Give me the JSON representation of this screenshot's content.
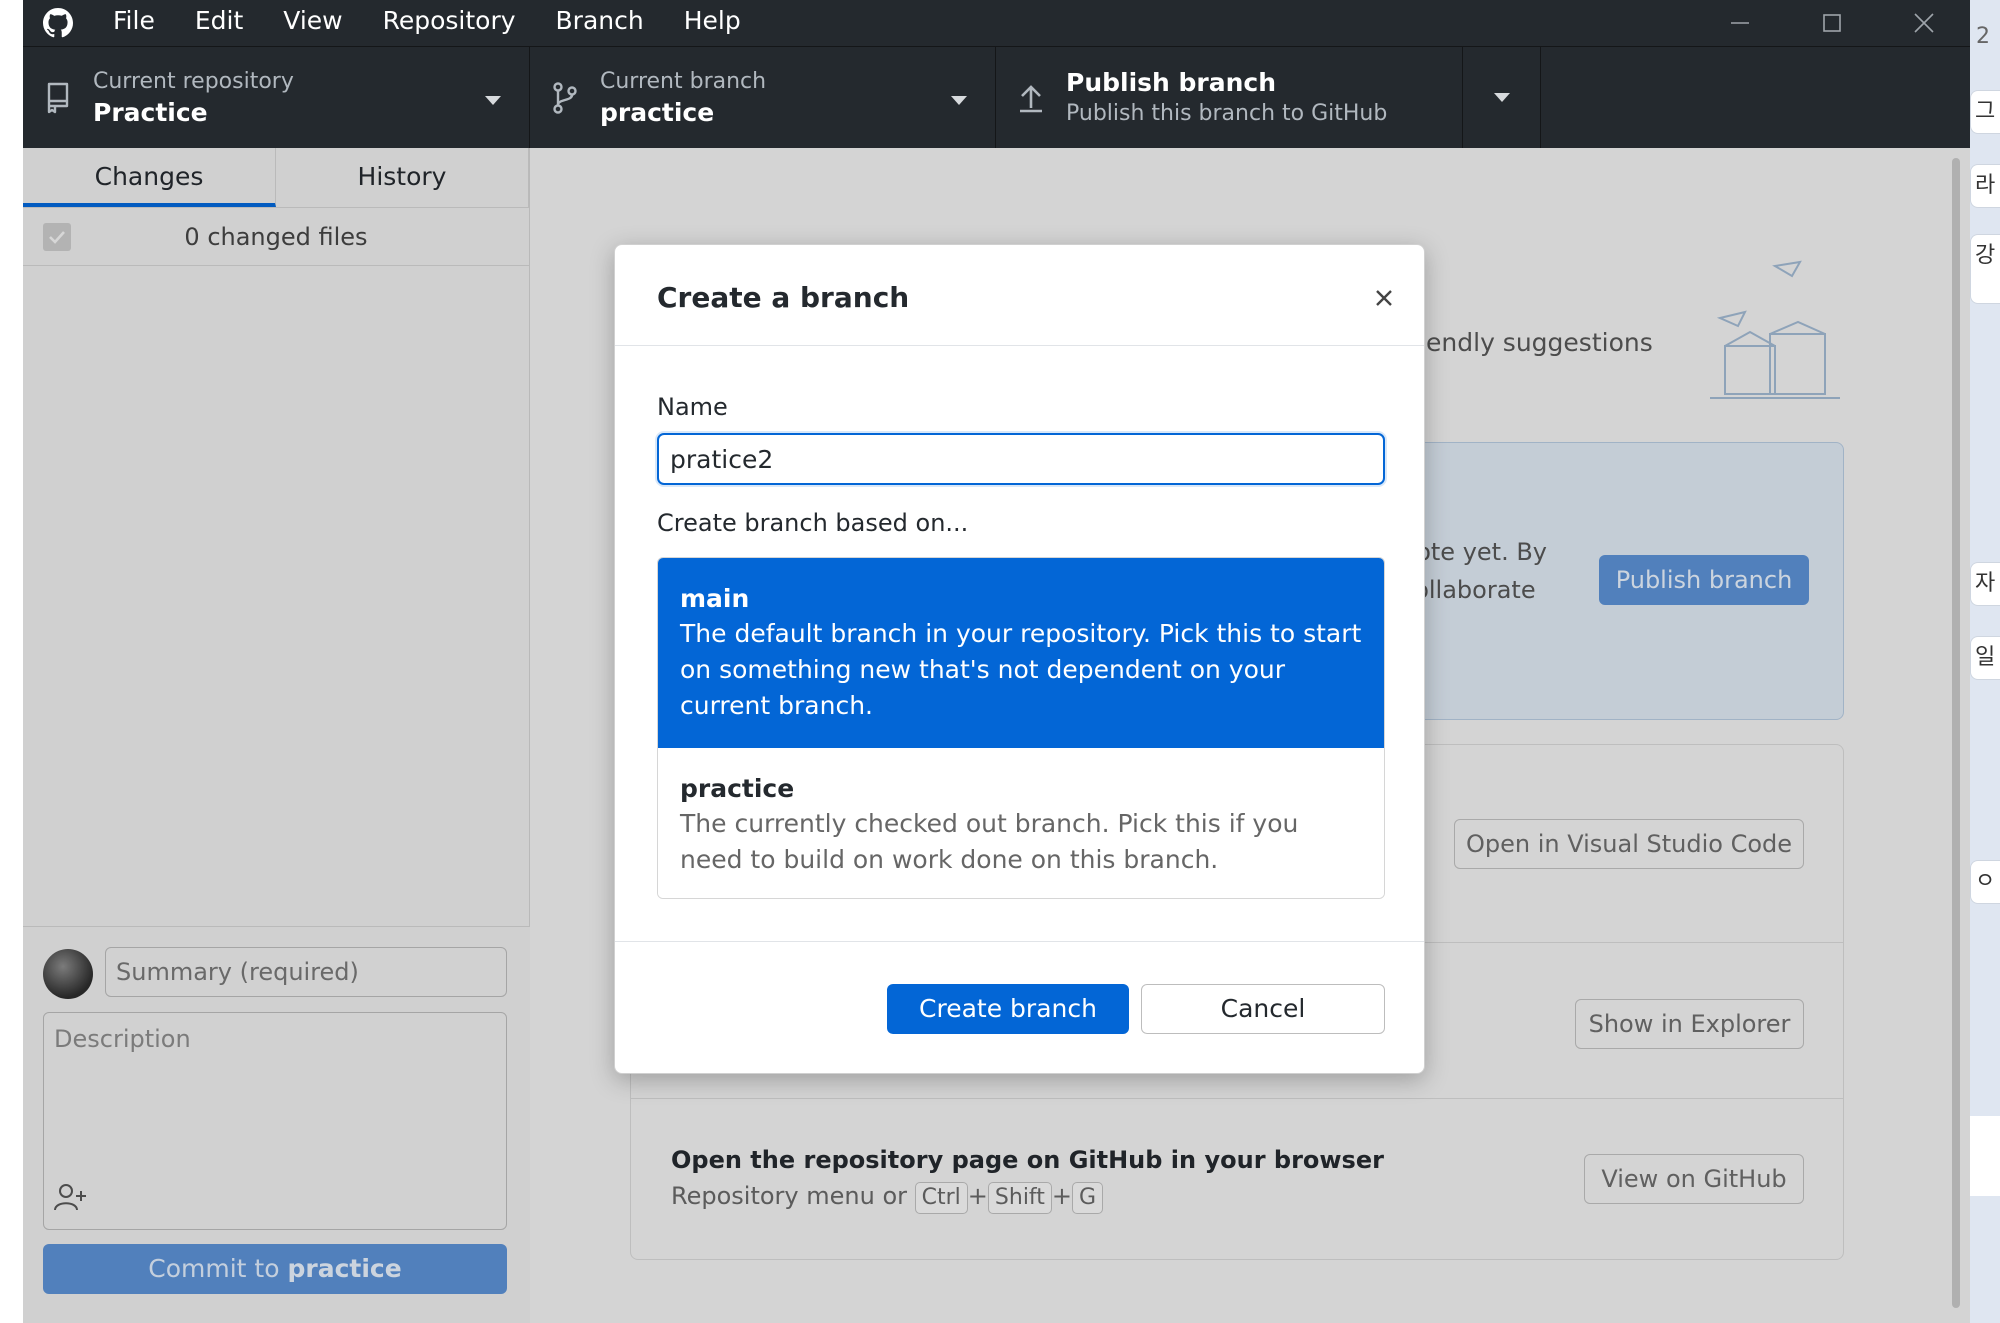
{
  "menu": [
    "File",
    "Edit",
    "View",
    "Repository",
    "Branch",
    "Help"
  ],
  "toolbar": {
    "repo_label": "Current repository",
    "repo_value": "Practice",
    "branch_label": "Current branch",
    "branch_value": "practice",
    "publish_title": "Publish branch",
    "publish_sub": "Publish this branch to GitHub"
  },
  "sidebar": {
    "tabs": [
      "Changes",
      "History"
    ],
    "changed_files": "0 changed files",
    "summary_placeholder": "Summary (required)",
    "description_placeholder": "Description",
    "commit_prefix": "Commit to",
    "commit_branch": "practice"
  },
  "main": {
    "friendly": "friendly suggestions",
    "publish_text_1": "note yet. By",
    "publish_text_2": "collaborate",
    "publish_button": "Publish branch",
    "open_editor_button": "Open in Visual Studio Code",
    "show_explorer_button": "Show in Explorer",
    "github_title": "Open the repository page on GitHub in your browser",
    "github_sub_prefix": "Repository menu or",
    "keys": [
      "Ctrl",
      "Shift",
      "G"
    ],
    "view_github_button": "View on GitHub"
  },
  "dialog": {
    "title": "Create a branch",
    "name_label": "Name",
    "name_value": "pratice2",
    "based_label": "Create branch based on...",
    "options": [
      {
        "name": "main",
        "desc": "The default branch in your repository. Pick this to start on something new that's not dependent on your current branch."
      },
      {
        "name": "practice",
        "desc": "The currently checked out branch. Pick this if you need to build on work done on this branch."
      }
    ],
    "create_button": "Create branch",
    "cancel_button": "Cancel"
  },
  "outside_right": [
    "2",
    "그",
    "라",
    "강",
    "자",
    "일",
    "ㅇ"
  ],
  "colors": {
    "accent": "#0366d6",
    "titlebar": "#24292e"
  }
}
